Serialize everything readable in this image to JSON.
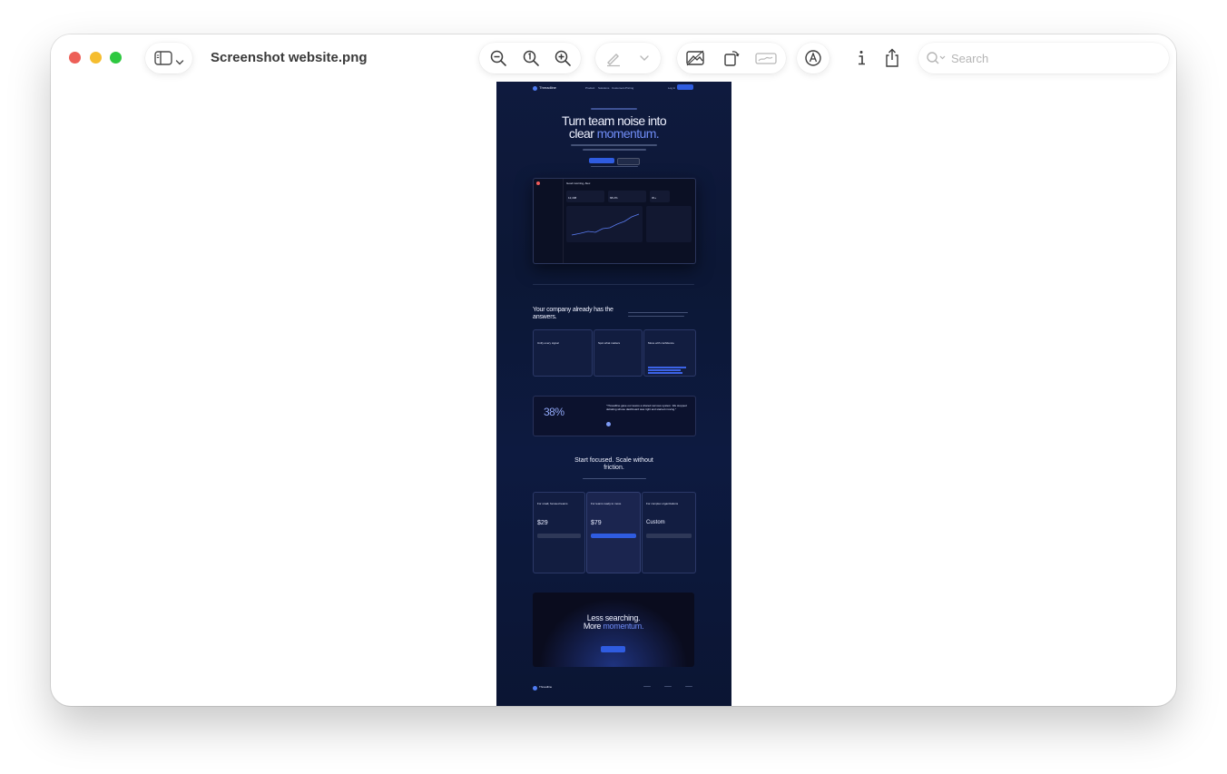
{
  "window": {
    "file_title": "Screenshot website.png",
    "search_placeholder": "Search"
  },
  "toolbar": {
    "icons": [
      "sidebar-icon",
      "chevron-down-icon",
      "zoom-out-icon",
      "actual-size-icon",
      "zoom-in-icon",
      "highlight-pen-icon",
      "chevron-down-icon",
      "crop-image-icon",
      "rotate-icon",
      "signature-icon",
      "markup-icon",
      "info-icon",
      "share-icon",
      "search-icon"
    ]
  },
  "doc": {
    "brand": "Threadline",
    "nav": [
      "Product",
      "Solutions",
      "Customers",
      "Pricing"
    ],
    "login": "Log in",
    "cta_nav": "Get started",
    "hero_tag": "NEW: AI THREAD SUMMARIES",
    "hero_line1": "Turn team noise into",
    "hero_line2_plain": "clear ",
    "hero_line2_accent": "momentum.",
    "app_title": "Good morning, Alex",
    "stats": [
      "12,408",
      "68.2%",
      "3h+"
    ],
    "section2_title_1": "Your company already has the",
    "section2_title_2": "answers.",
    "features": [
      "Unify every signal",
      "Spot what matters",
      "Move with confidence"
    ],
    "metric_value": "38%",
    "quote": "\"Threadline gave our teams a shared nervous system. We stopped debating whose dashboard was right and started moving.\"",
    "pricing_title_1": "Start focused. Scale without",
    "pricing_title_2": "friction.",
    "plans": [
      {
        "title": "For small, focused teams",
        "price": "$29"
      },
      {
        "title": "For teams ready to move",
        "price": "$79"
      },
      {
        "title": "For complex organizations",
        "price": "Custom"
      }
    ],
    "cta_line1": "Less searching.",
    "cta_line2_plain": "More ",
    "cta_line2_accent": "momentum.",
    "footer_brand": "Threadline"
  },
  "colors": {
    "accent": "#2f5ce0",
    "page_bg": "#0d1a40"
  }
}
